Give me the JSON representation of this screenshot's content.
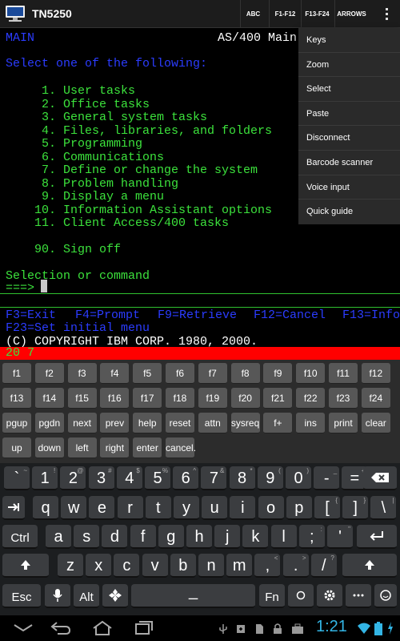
{
  "app": {
    "title": "TN5250"
  },
  "actionbar": {
    "buttons": [
      "ABC",
      "F1-F12",
      "F13-F24",
      "ARROWS"
    ]
  },
  "menu": {
    "items": [
      "Keys",
      "Zoom",
      "Select",
      "Paste",
      "Disconnect",
      "Barcode scanner",
      "Voice input",
      "Quick guide"
    ]
  },
  "terminal": {
    "screen_id": "MAIN",
    "header_right": "AS/400 Main",
    "prompt": "Select one of the following:",
    "options": [
      "1. User tasks",
      "2. Office tasks",
      "3. General system tasks",
      "4. Files, libraries, and folders",
      "5. Programming",
      "6. Communications",
      "7. Define or change the system",
      "8. Problem handling",
      "9. Display a menu",
      "10. Information Assistant options",
      "11. Client Access/400 tasks"
    ],
    "signoff": "90. Sign off",
    "selection_label": "Selection or command",
    "input_prompt": "===>",
    "fkeys": [
      {
        "key": "F3",
        "label": "=Exit"
      },
      {
        "key": "F4",
        "label": "=Prompt"
      },
      {
        "key": "F9",
        "label": "=Retrieve"
      },
      {
        "key": "F12",
        "label": "=Cancel"
      },
      {
        "key": "F13",
        "label": "=Info"
      },
      {
        "key": "F23",
        "label": "=Set initial menu"
      }
    ],
    "copyright": "(C) COPYRIGHT IBM CORP. 1980, 2000.",
    "status": "20 7"
  },
  "terminal_keys": {
    "row1": [
      "f1",
      "f2",
      "f3",
      "f4",
      "f5",
      "f6",
      "f7",
      "f8",
      "f9",
      "f10",
      "f11",
      "f12"
    ],
    "row2": [
      "f13",
      "f14",
      "f15",
      "f16",
      "f17",
      "f18",
      "f19",
      "f20",
      "f21",
      "f22",
      "f23",
      "f24"
    ],
    "row3": [
      "pgup",
      "pgdn",
      "next",
      "prev",
      "help",
      "reset",
      "attn",
      "sysreq",
      "f+",
      "ins",
      "print",
      "clear"
    ],
    "row4": [
      "up",
      "down",
      "left",
      "right",
      "enter",
      "cancel."
    ]
  },
  "keyboard": {
    "row1": [
      [
        "`",
        "~"
      ],
      [
        "1",
        "!"
      ],
      [
        "2",
        "@"
      ],
      [
        "3",
        "#"
      ],
      [
        "4",
        "$"
      ],
      [
        "5",
        "%"
      ],
      [
        "6",
        "^"
      ],
      [
        "7",
        "&"
      ],
      [
        "8",
        "*"
      ],
      [
        "9",
        "("
      ],
      [
        "0",
        ")"
      ],
      [
        "-",
        "_"
      ],
      [
        "=",
        "+"
      ]
    ],
    "row2": [
      [
        "q",
        ""
      ],
      [
        "w",
        ""
      ],
      [
        "e",
        ""
      ],
      [
        "r",
        ""
      ],
      [
        "t",
        ""
      ],
      [
        "y",
        ""
      ],
      [
        "u",
        ""
      ],
      [
        "i",
        ""
      ],
      [
        "o",
        ""
      ],
      [
        "p",
        ""
      ],
      [
        "[",
        "{"
      ],
      [
        "]",
        "}"
      ],
      [
        "\\",
        "|"
      ]
    ],
    "row3": [
      [
        "a",
        ""
      ],
      [
        "s",
        ""
      ],
      [
        "d",
        ""
      ],
      [
        "f",
        ""
      ],
      [
        "g",
        ""
      ],
      [
        "h",
        ""
      ],
      [
        "j",
        ""
      ],
      [
        "k",
        ""
      ],
      [
        "l",
        ""
      ],
      [
        ";",
        ":"
      ],
      [
        "'",
        "\""
      ]
    ],
    "row4": [
      [
        "z",
        ""
      ],
      [
        "x",
        ""
      ],
      [
        "c",
        ""
      ],
      [
        "v",
        ""
      ],
      [
        "b",
        ""
      ],
      [
        "n",
        ""
      ],
      [
        "m",
        ""
      ],
      [
        ",",
        "<"
      ],
      [
        ".",
        ">"
      ],
      [
        "/",
        "?"
      ]
    ],
    "ctrl": "Ctrl",
    "esc": "Esc",
    "alt": "Alt",
    "fn": "Fn",
    "space": "_"
  },
  "status": {
    "time": "1:21"
  },
  "colors": {
    "terminal_blue": "#2b3cff",
    "terminal_green": "#3ce23c",
    "status_red": "#ff0000",
    "clock_blue": "#33b5e5"
  }
}
